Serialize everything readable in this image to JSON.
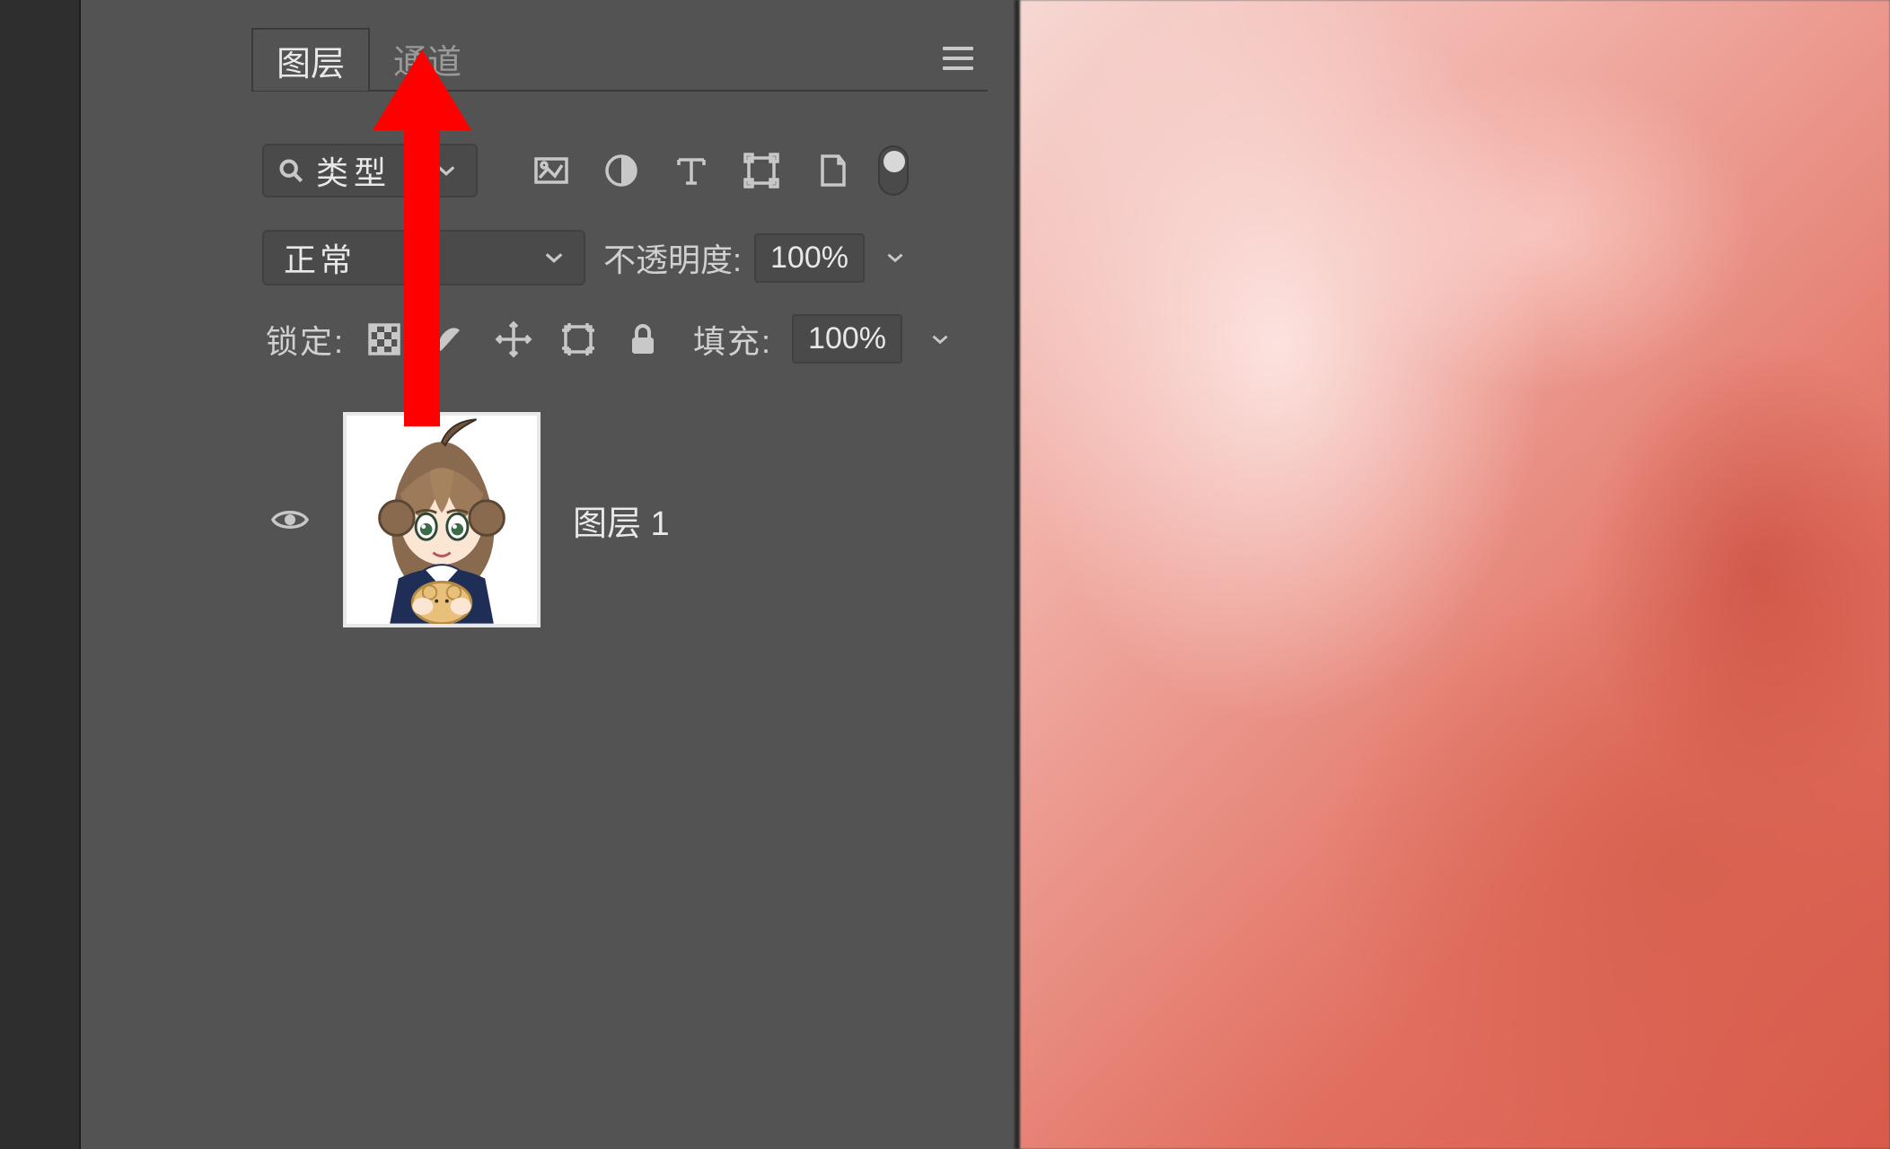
{
  "tabs": {
    "layers": "图层",
    "channels": "通道"
  },
  "filter": {
    "search_label": "类型"
  },
  "blend": {
    "mode": "正常",
    "opacity_label": "不透明度:",
    "opacity_value": "100%"
  },
  "lock": {
    "label": "锁定:",
    "fill_label": "填充:",
    "fill_value": "100%"
  },
  "layer": {
    "name": "图层 1"
  }
}
